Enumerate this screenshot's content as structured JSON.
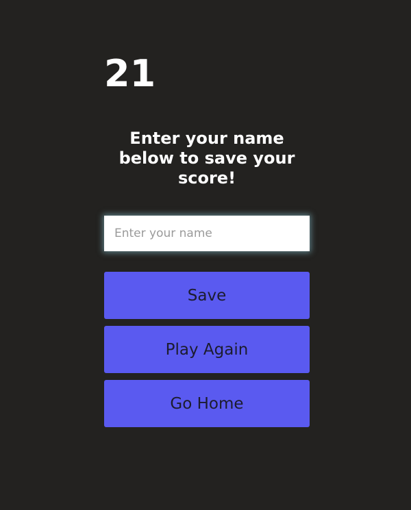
{
  "score": "21",
  "prompt": "Enter your name below to save your score!",
  "name_input": {
    "value": "",
    "placeholder": "Enter your name"
  },
  "buttons": {
    "save_label": "Save",
    "play_again_label": "Play Again",
    "go_home_label": "Go Home"
  },
  "colors": {
    "background": "#232220",
    "button": "#5a5af0",
    "button_text": "#1c1c2e",
    "text": "#ffffff"
  }
}
